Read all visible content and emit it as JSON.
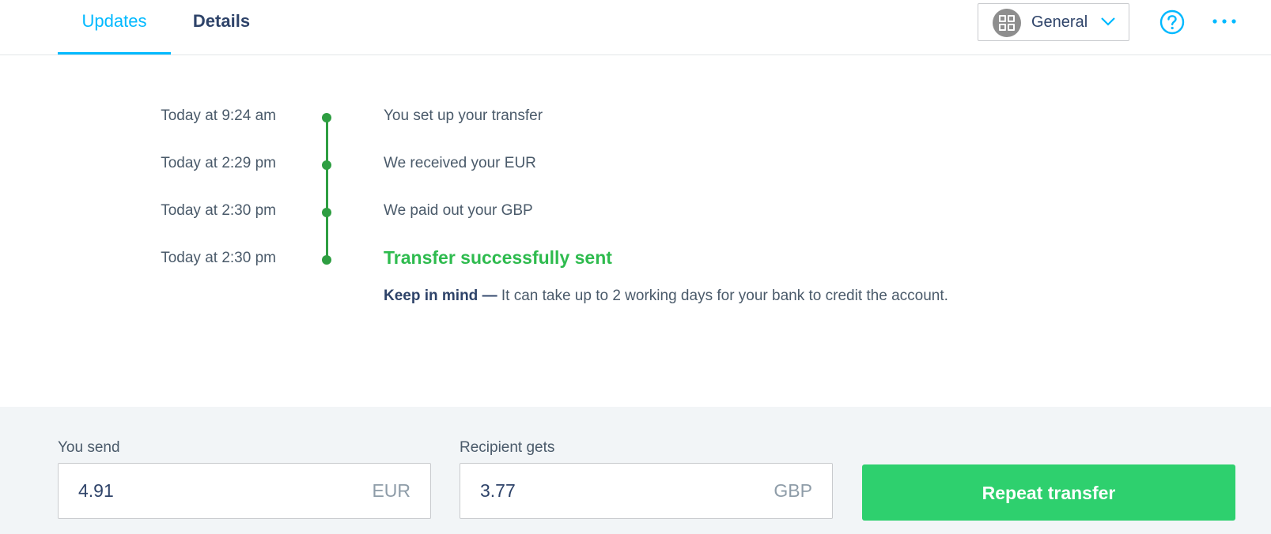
{
  "tabs": [
    {
      "label": "Updates",
      "active": true
    },
    {
      "label": "Details",
      "active": false
    }
  ],
  "profile": {
    "label": "General",
    "icon": "profile-grid-icon"
  },
  "header_icons": {
    "help": "help-circle-icon",
    "more": "more-dots-icon"
  },
  "timeline": {
    "events": [
      {
        "time": "Today at 9:24 am",
        "text": "You set up your transfer"
      },
      {
        "time": "Today at 2:29 pm",
        "text": "We received your EUR"
      },
      {
        "time": "Today at 2:30 pm",
        "text": "We paid out your GBP"
      },
      {
        "time": "Today at 2:30 pm",
        "text": "Transfer successfully sent"
      }
    ],
    "note_strong": "Keep in mind —",
    "note_text": " It can take up to 2 working days for your bank to credit the account."
  },
  "send": {
    "label": "You send",
    "amount": "4.91",
    "currency": "EUR"
  },
  "receive": {
    "label": "Recipient gets",
    "amount": "3.77",
    "currency": "GBP"
  },
  "repeat_button": "Repeat transfer",
  "colors": {
    "accent": "#00b9ff",
    "success": "#2ebb4e",
    "timeline": "#2e9e41",
    "button": "#2ed06e"
  }
}
